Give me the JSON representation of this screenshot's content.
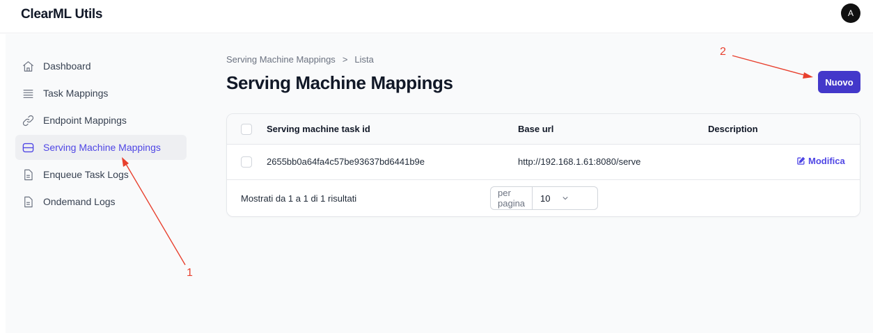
{
  "app": {
    "title": "ClearML Utils",
    "avatar_initial": "A"
  },
  "sidebar": {
    "items": [
      {
        "label": "Dashboard",
        "icon": "home-icon",
        "active": false
      },
      {
        "label": "Task Mappings",
        "icon": "list-icon",
        "active": false
      },
      {
        "label": "Endpoint Mappings",
        "icon": "link-icon",
        "active": false
      },
      {
        "label": "Serving Machine Mappings",
        "icon": "database-icon",
        "active": true
      },
      {
        "label": "Enqueue Task Logs",
        "icon": "document-icon",
        "active": false
      },
      {
        "label": "Ondemand Logs",
        "icon": "document-icon",
        "active": false
      }
    ]
  },
  "breadcrumb": {
    "parent": "Serving Machine Mappings",
    "separator": ">",
    "current": "Lista"
  },
  "page": {
    "title": "Serving Machine Mappings",
    "new_button": "Nuovo"
  },
  "table": {
    "columns": [
      "Serving machine task id",
      "Base url",
      "Description"
    ],
    "rows": [
      {
        "task_id": "2655bb0a64fa4c57be93637bd6441b9e",
        "base_url": "http://192.168.1.61:8080/serve",
        "description": "",
        "action": "Modifica"
      }
    ],
    "footer_text": "Mostrati da 1 a 1 di 1 risultati",
    "per_page_label": "per pagina",
    "per_page_value": "10"
  },
  "annotations": {
    "marker_1": "1",
    "marker_2": "2"
  },
  "colors": {
    "accent": "#4f46e5",
    "button": "#4338ca",
    "annotation": "#e8402e"
  }
}
